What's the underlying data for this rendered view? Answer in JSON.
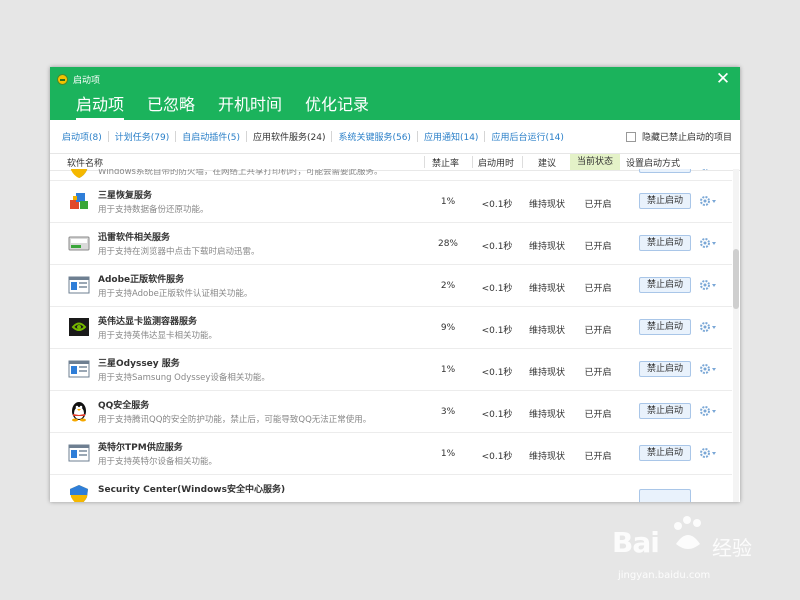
{
  "window": {
    "title": "启动项",
    "main_tabs": [
      "启动项",
      "已忽略",
      "开机时间",
      "优化记录"
    ],
    "close_label": "✕"
  },
  "subtabs": [
    {
      "label": "启动项(8)"
    },
    {
      "label": "计划任务(79)"
    },
    {
      "label": "自启动插件(5)"
    },
    {
      "label": "应用软件服务(24)"
    },
    {
      "label": "系统关键服务(56)"
    },
    {
      "label": "应用通知(14)"
    },
    {
      "label": "应用后台运行(14)"
    }
  ],
  "hide_disabled_label": "隐藏已禁止启动的项目",
  "columns": {
    "name": "软件名称",
    "rate": "禁止率",
    "time": "启动用时",
    "suggest": "建议",
    "status": "当前状态",
    "setting": "设置启动方式"
  },
  "rows": [
    {
      "name": "",
      "desc": "Windows系统自带的防火墙，在网络上共享打印机时，可能会需要此服务。",
      "rate": "",
      "time": "",
      "suggest": "",
      "status": "",
      "button": "禁止启动",
      "icon": "shield-icon",
      "partial": true
    },
    {
      "name": "三星恢复服务",
      "desc": "用于支持数据备份还原功能。",
      "rate": "1%",
      "time": "<0.1秒",
      "suggest": "维持现状",
      "status": "已开启",
      "button": "禁止启动",
      "icon": "blocks-icon"
    },
    {
      "name": "迅雷软件相关服务",
      "desc": "用于支持在浏览器中点击下载时启动迅雷。",
      "rate": "28%",
      "time": "<0.1秒",
      "suggest": "维持现状",
      "status": "已开启",
      "button": "禁止启动",
      "icon": "device-icon"
    },
    {
      "name": "Adobe正版软件服务",
      "desc": "用于支持Adobe正版软件认证相关功能。",
      "rate": "2%",
      "time": "<0.1秒",
      "suggest": "维持现状",
      "status": "已开启",
      "button": "禁止启动",
      "icon": "window-icon"
    },
    {
      "name": "英伟达显卡监测容器服务",
      "desc": "用于支持英伟达显卡相关功能。",
      "rate": "9%",
      "time": "<0.1秒",
      "suggest": "维持现状",
      "status": "已开启",
      "button": "禁止启动",
      "icon": "nvidia-icon"
    },
    {
      "name": "三星Odyssey 服务",
      "desc": "用于支持Samsung Odyssey设备相关功能。",
      "rate": "1%",
      "time": "<0.1秒",
      "suggest": "维持现状",
      "status": "已开启",
      "button": "禁止启动",
      "icon": "window-icon"
    },
    {
      "name": "QQ安全服务",
      "desc": "用于支持腾讯QQ的安全防护功能，禁止后，可能导致QQ无法正常使用。",
      "rate": "3%",
      "time": "<0.1秒",
      "suggest": "维持现状",
      "status": "已开启",
      "button": "禁止启动",
      "icon": "penguin-icon"
    },
    {
      "name": "英特尔TPM供应服务",
      "desc": "用于支持英特尔设备相关功能。",
      "rate": "1%",
      "time": "<0.1秒",
      "suggest": "维持现状",
      "status": "已开启",
      "button": "禁止启动",
      "icon": "window-icon"
    },
    {
      "name": "Security Center(Windows安全中心服务)",
      "desc": "",
      "rate": "",
      "time": "",
      "suggest": "",
      "status": "",
      "button": "",
      "icon": "shield-icon"
    }
  ],
  "watermark": {
    "brand": "Bai",
    "suffix": "经验",
    "url": "jingyan.baidu.com"
  },
  "colors": {
    "header_green": "#1bb35c",
    "link_blue": "#2a7fc8",
    "status_highlight": "#e4f2c8"
  }
}
